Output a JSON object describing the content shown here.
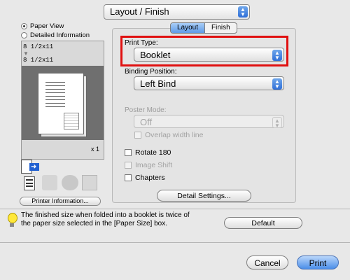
{
  "section_popup": {
    "value": "Layout / Finish"
  },
  "view_options": {
    "paper_view": "Paper View",
    "detailed_information": "Detailed Information"
  },
  "preview": {
    "size_top": "8 1/2x11",
    "size_bottom": "8 1/2x11",
    "copies": "x 1"
  },
  "printer_info_button": "Printer Information...",
  "tabs": {
    "layout": "Layout",
    "finish": "Finish"
  },
  "print_type": {
    "label": "Print Type:",
    "value": "Booklet"
  },
  "binding_position": {
    "label": "Binding Position:",
    "value": "Left Bind"
  },
  "poster_mode": {
    "label": "Poster Mode:",
    "value": "Off",
    "overlap": "Overlap width line"
  },
  "options": {
    "rotate": "Rotate 180",
    "image_shift": "Image Shift",
    "chapters": "Chapters"
  },
  "detail_settings_button": "Detail Settings...",
  "message": {
    "line1": "The finished size when folded into a booklet is twice of",
    "line2": "the paper size selected in the [Paper Size] box."
  },
  "default_button": "Default",
  "cancel_button": "Cancel",
  "print_button": "Print",
  "colors": {
    "highlight": "#e01010",
    "aqua_blue": "#4b8ee8"
  }
}
